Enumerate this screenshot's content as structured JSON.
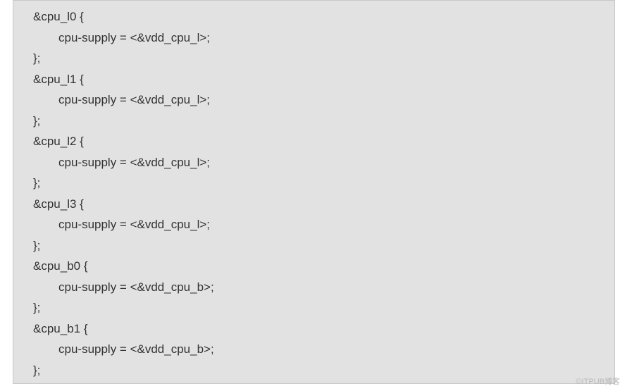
{
  "code": {
    "lines": [
      {
        "text": "&cpu_l0 {",
        "indent": false
      },
      {
        "text": "cpu-supply = <&vdd_cpu_l>;",
        "indent": true
      },
      {
        "text": "};",
        "indent": false
      },
      {
        "text": "&cpu_l1 {",
        "indent": false
      },
      {
        "text": "cpu-supply = <&vdd_cpu_l>;",
        "indent": true
      },
      {
        "text": "};",
        "indent": false
      },
      {
        "text": "&cpu_l2 {",
        "indent": false
      },
      {
        "text": "cpu-supply = <&vdd_cpu_l>;",
        "indent": true
      },
      {
        "text": "};",
        "indent": false
      },
      {
        "text": "&cpu_l3 {",
        "indent": false
      },
      {
        "text": "cpu-supply = <&vdd_cpu_l>;",
        "indent": true
      },
      {
        "text": "};",
        "indent": false
      },
      {
        "text": "&cpu_b0 {",
        "indent": false
      },
      {
        "text": "cpu-supply = <&vdd_cpu_b>;",
        "indent": true
      },
      {
        "text": "};",
        "indent": false
      },
      {
        "text": "&cpu_b1 {",
        "indent": false
      },
      {
        "text": "cpu-supply = <&vdd_cpu_b>;",
        "indent": true
      },
      {
        "text": "};",
        "indent": false
      }
    ]
  },
  "watermark": "©ITPUB博客"
}
